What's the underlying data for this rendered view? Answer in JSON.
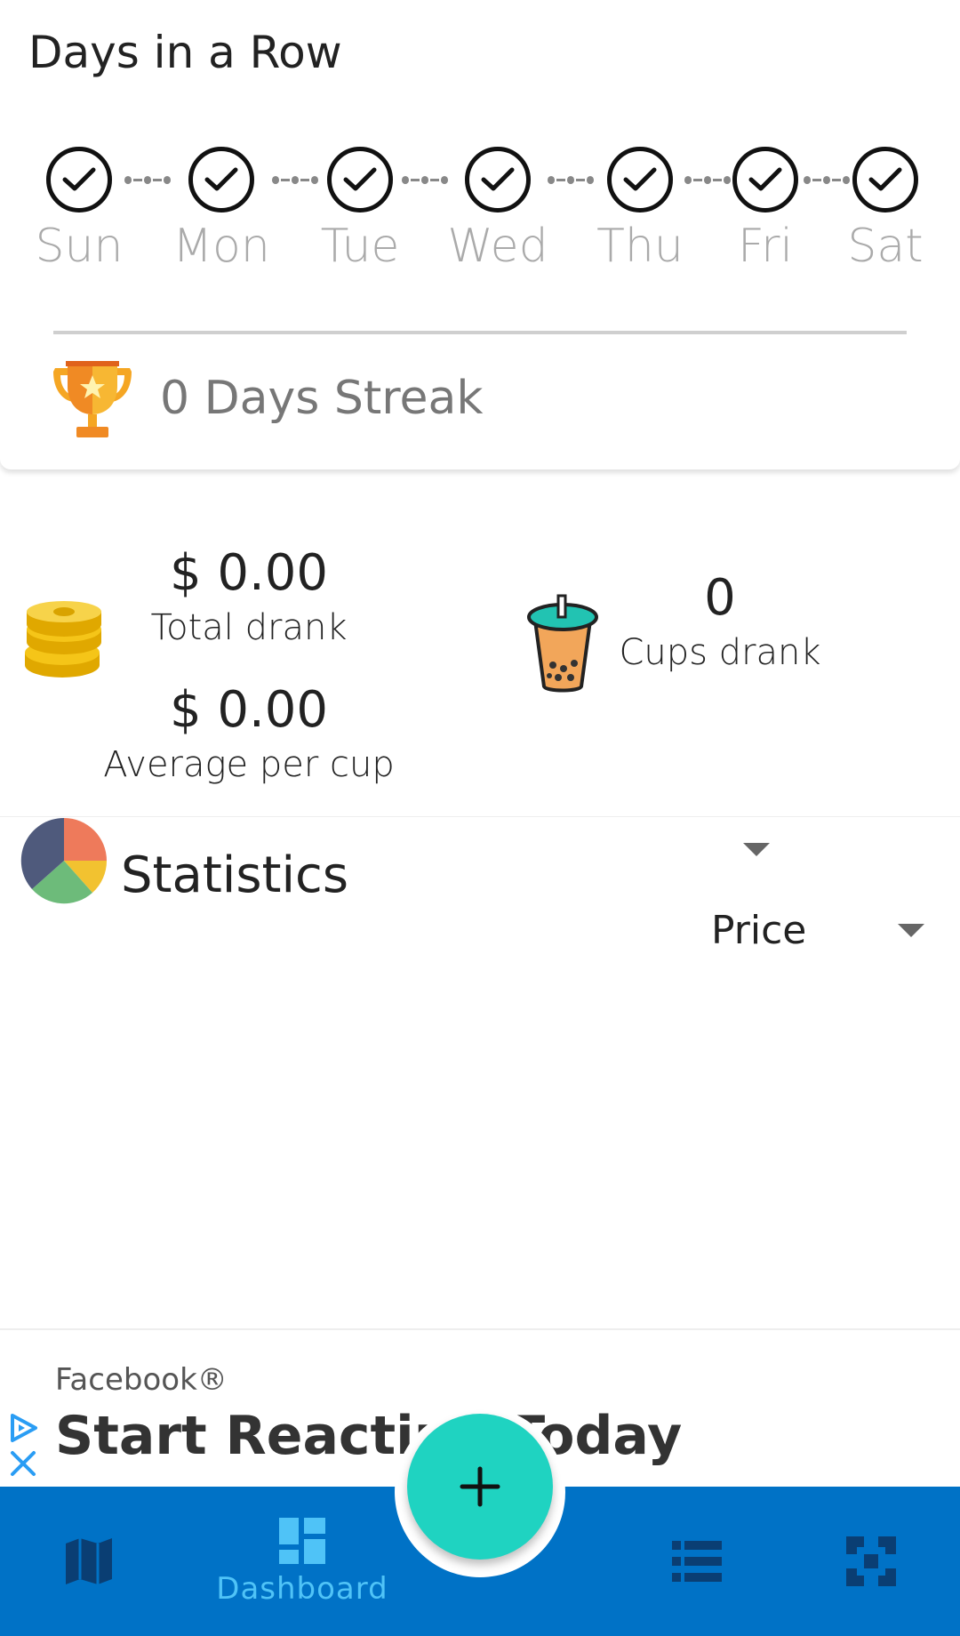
{
  "streak_card": {
    "title": "Days in a Row",
    "days": [
      "Sun",
      "Mon",
      "Tue",
      "Wed",
      "Thu",
      "Fri",
      "Sat"
    ],
    "streak_text": "0 Days Streak"
  },
  "money": {
    "total_value": "$ 0.00",
    "total_label": "Total drank",
    "average_value": "$ 0.00",
    "average_label": "Average per cup"
  },
  "cups": {
    "value": "0",
    "label": "Cups drank"
  },
  "statistics": {
    "title": "Statistics",
    "filter_selected": "Price"
  },
  "ad": {
    "brand": "Facebook®",
    "headline": "Start Reacting Today"
  },
  "bottom_nav": {
    "dashboard_label": "Dashboard",
    "items": [
      "map-icon",
      "dashboard-icon",
      "list-icon",
      "settings-icon"
    ]
  },
  "colors": {
    "nav_bg": "#0072c6",
    "nav_active": "#4fc3f7",
    "fab": "#1fd3c1"
  }
}
